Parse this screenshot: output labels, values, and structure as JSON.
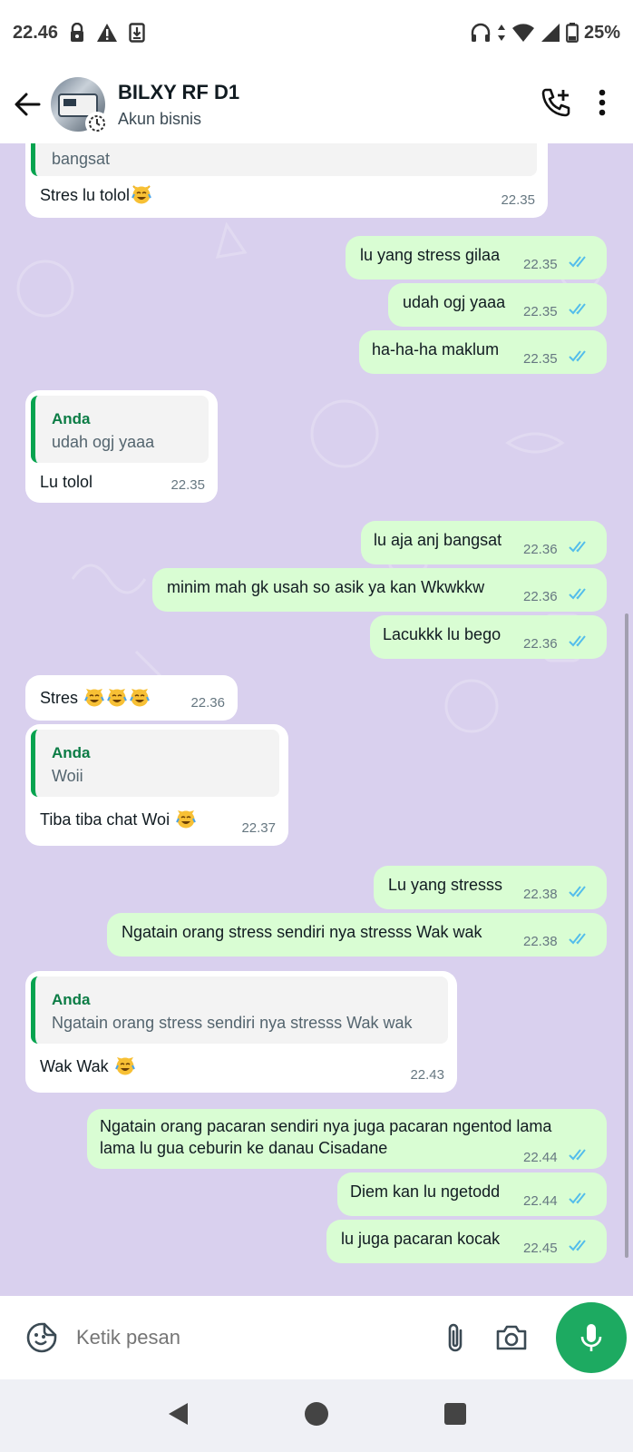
{
  "status_bar": {
    "time": "22.46",
    "battery": "25%"
  },
  "header": {
    "name": "BILXY RF D1",
    "subtitle": "Akun bisnis"
  },
  "messages": [
    {
      "dir": "in",
      "quote_tail": "bangsat",
      "text": "Stres lu tolol",
      "emoji": true,
      "time": "22.35"
    },
    {
      "dir": "out",
      "text": "lu yang stress gilaa",
      "time": "22.35"
    },
    {
      "dir": "out",
      "text": "udah ogj yaaa",
      "time": "22.35"
    },
    {
      "dir": "out",
      "text": "ha-ha-ha maklum",
      "time": "22.35"
    },
    {
      "dir": "in",
      "quote_author": "Anda",
      "quote_text": "udah ogj yaaa",
      "text": "Lu tolol",
      "time": "22.35"
    },
    {
      "dir": "out",
      "text": "lu aja anj bangsat",
      "time": "22.36"
    },
    {
      "dir": "out",
      "text": "minim mah gk usah so asik ya kan Wkwkkw",
      "time": "22.36"
    },
    {
      "dir": "out",
      "text": "Lacukkk lu bego",
      "time": "22.36"
    },
    {
      "dir": "in",
      "text": "Stres",
      "emoji_count": 3,
      "time": "22.36"
    },
    {
      "dir": "in",
      "quote_author": "Anda",
      "quote_text": "Woii",
      "text": "Tiba tiba chat Woi",
      "emoji": true,
      "time": "22.37"
    },
    {
      "dir": "out",
      "text": "Lu yang stresss",
      "time": "22.38"
    },
    {
      "dir": "out",
      "text": "Ngatain orang stress sendiri nya stresss Wak wak",
      "time": "22.38"
    },
    {
      "dir": "in",
      "quote_author": "Anda",
      "quote_text": "Ngatain orang stress sendiri nya stresss Wak wak",
      "text": "Wak Wak",
      "emoji": true,
      "time": "22.43"
    },
    {
      "dir": "out",
      "text": "Ngatain orang pacaran sendiri nya juga pacaran ngentod lama",
      "text2": "lama lu gua ceburin ke danau Cisadane",
      "time": "22.44"
    },
    {
      "dir": "out",
      "text": "Diem kan lu ngetodd",
      "time": "22.44"
    },
    {
      "dir": "out",
      "text": "lu juga pacaran kocak",
      "time": "22.45"
    }
  ],
  "composer": {
    "placeholder": "Ketik pesan"
  },
  "icons": {
    "lock": "lock-icon",
    "warning": "warning-icon",
    "download": "download-icon",
    "headphones": "headphones-icon",
    "wifi": "wifi-icon",
    "signal": "signal-icon",
    "battery": "battery-icon",
    "back": "back-arrow-icon",
    "call_add": "add-call-icon",
    "menu": "more-vert-icon",
    "sticker": "sticker-icon",
    "attach": "paperclip-icon",
    "camera": "camera-icon",
    "mic": "mic-icon",
    "read": "double-check-icon"
  },
  "colors": {
    "chat_bg": "#d9d0ee",
    "outgoing": "#d9fdd3",
    "incoming": "#ffffff",
    "read_tick": "#53bdeb",
    "accent": "#1daa61",
    "quote_author": "#0b7c45"
  }
}
